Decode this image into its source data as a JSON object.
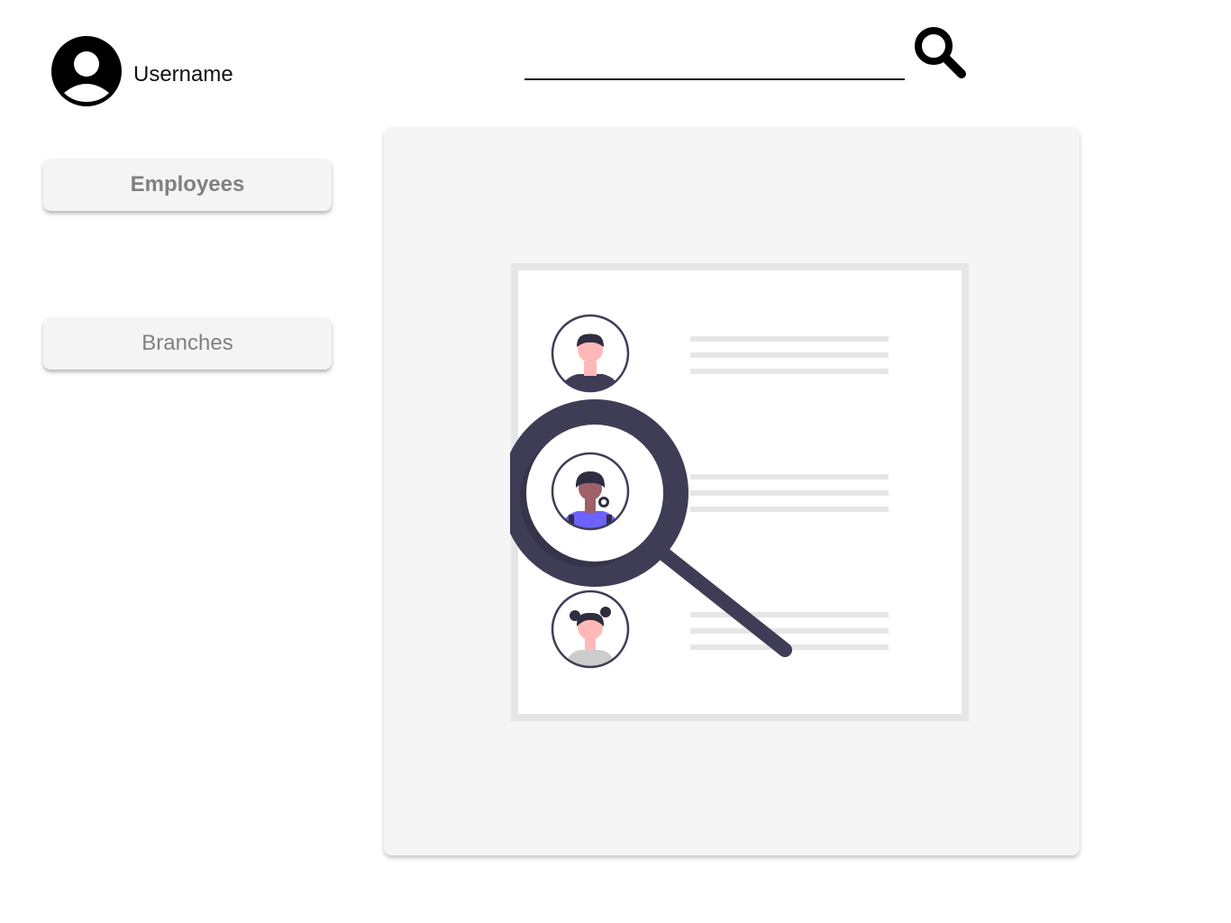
{
  "header": {
    "username": "Username",
    "search": {
      "value": "",
      "placeholder": ""
    },
    "icons": {
      "avatar": "user-avatar-icon",
      "search": "search-icon"
    }
  },
  "sidebar": {
    "items": [
      {
        "label": "Employees",
        "active": true
      },
      {
        "label": "Branches",
        "active": false
      }
    ]
  },
  "main": {
    "illustration": "people-search-illustration",
    "colors": {
      "panel": "#f5f5f5",
      "accent": "#6c63ff",
      "dark": "#3f3d56",
      "skin": "#ffb8b8",
      "line": "#e6e6e6"
    }
  }
}
